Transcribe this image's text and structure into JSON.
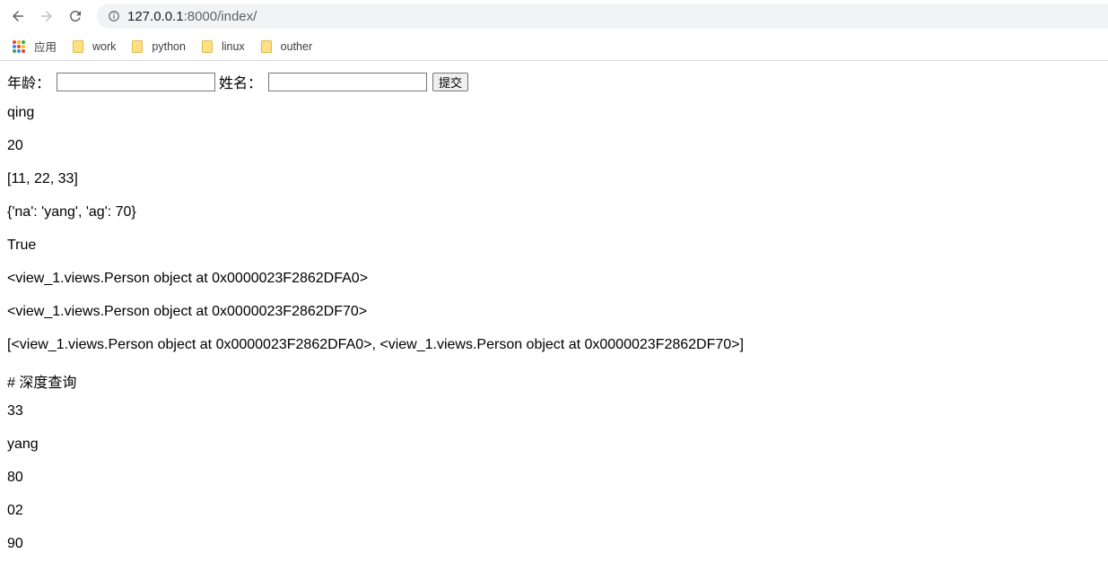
{
  "browser": {
    "url_host": "127.0.0.1",
    "url_rest": ":8000/index/",
    "bookmarks": [
      {
        "label": "应用"
      },
      {
        "label": "work"
      },
      {
        "label": "python"
      },
      {
        "label": "linux"
      },
      {
        "label": "outher"
      }
    ]
  },
  "form": {
    "age_label": "年龄：",
    "age_value": "",
    "name_label": "姓名：",
    "name_value": "",
    "submit_label": "提交"
  },
  "lines": [
    "qing",
    "20",
    "[11, 22, 33]",
    "{'na': 'yang', 'ag': 70}",
    "True",
    "<view_1.views.Person object at 0x0000023F2862DFA0>",
    "<view_1.views.Person object at 0x0000023F2862DF70>",
    "[<view_1.views.Person object at 0x0000023F2862DFA0>, <view_1.views.Person object at 0x0000023F2862DF70>]",
    "# 深度查询",
    "33",
    "yang",
    "80",
    "02",
    "90"
  ]
}
